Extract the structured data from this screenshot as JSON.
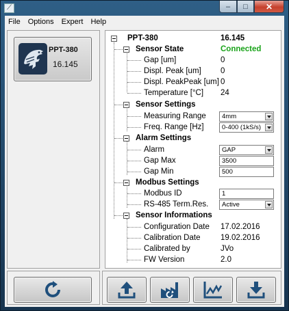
{
  "window": {
    "app_icon": "app-logo-icon",
    "minimize": "–",
    "maximize": "□",
    "close": "✕"
  },
  "menu": [
    "File",
    "Options",
    "Expert",
    "Help"
  ],
  "device": {
    "name": "PPT-380",
    "value": "16.145",
    "icon": "eagle-logo-icon"
  },
  "tree": {
    "root_label": "PPT-380",
    "root_value": "16.145",
    "sensor_state": {
      "title": "Sensor State",
      "status": "Connected",
      "status_color": "#1aa31a",
      "items": [
        {
          "label": "Gap [um]",
          "value": "0"
        },
        {
          "label": "Displ. Peak [um]",
          "value": "0"
        },
        {
          "label": "Displ. PeakPeak [um]",
          "value": "0"
        },
        {
          "label": "Temperature [°C]",
          "value": "24"
        }
      ]
    },
    "sensor_settings": {
      "title": "Sensor Settings",
      "measuring_range_label": "Measuring Range",
      "measuring_range_value": "4mm",
      "freq_range_label": "Freq. Range [Hz]",
      "freq_range_value": "0-400 (1kS/s)"
    },
    "alarm_settings": {
      "title": "Alarm Settings",
      "alarm_label": "Alarm",
      "alarm_value": "GAP",
      "gap_max_label": "Gap Max",
      "gap_max_value": "3500",
      "gap_min_label": "Gap Min",
      "gap_min_value": "500"
    },
    "modbus_settings": {
      "title": "Modbus Settings",
      "modbus_id_label": "Modbus ID",
      "modbus_id_value": "1",
      "rs485_label": "RS-485 Term.Res.",
      "rs485_value": "Active"
    },
    "sensor_info": {
      "title": "Sensor Informations",
      "items": [
        {
          "label": "Configuration Date",
          "value": "17.02.2016"
        },
        {
          "label": "Calibration Date",
          "value": "19.02.2016"
        },
        {
          "label": "Calibrated by",
          "value": "JVo"
        },
        {
          "label": "FW Version",
          "value": "2.0"
        }
      ]
    }
  },
  "toolbar": {
    "refresh_icon": "refresh-icon",
    "upload_icon": "upload-icon",
    "factory_reset_icon": "factory-reset-icon",
    "chart_icon": "chart-icon",
    "download_icon": "download-icon"
  }
}
